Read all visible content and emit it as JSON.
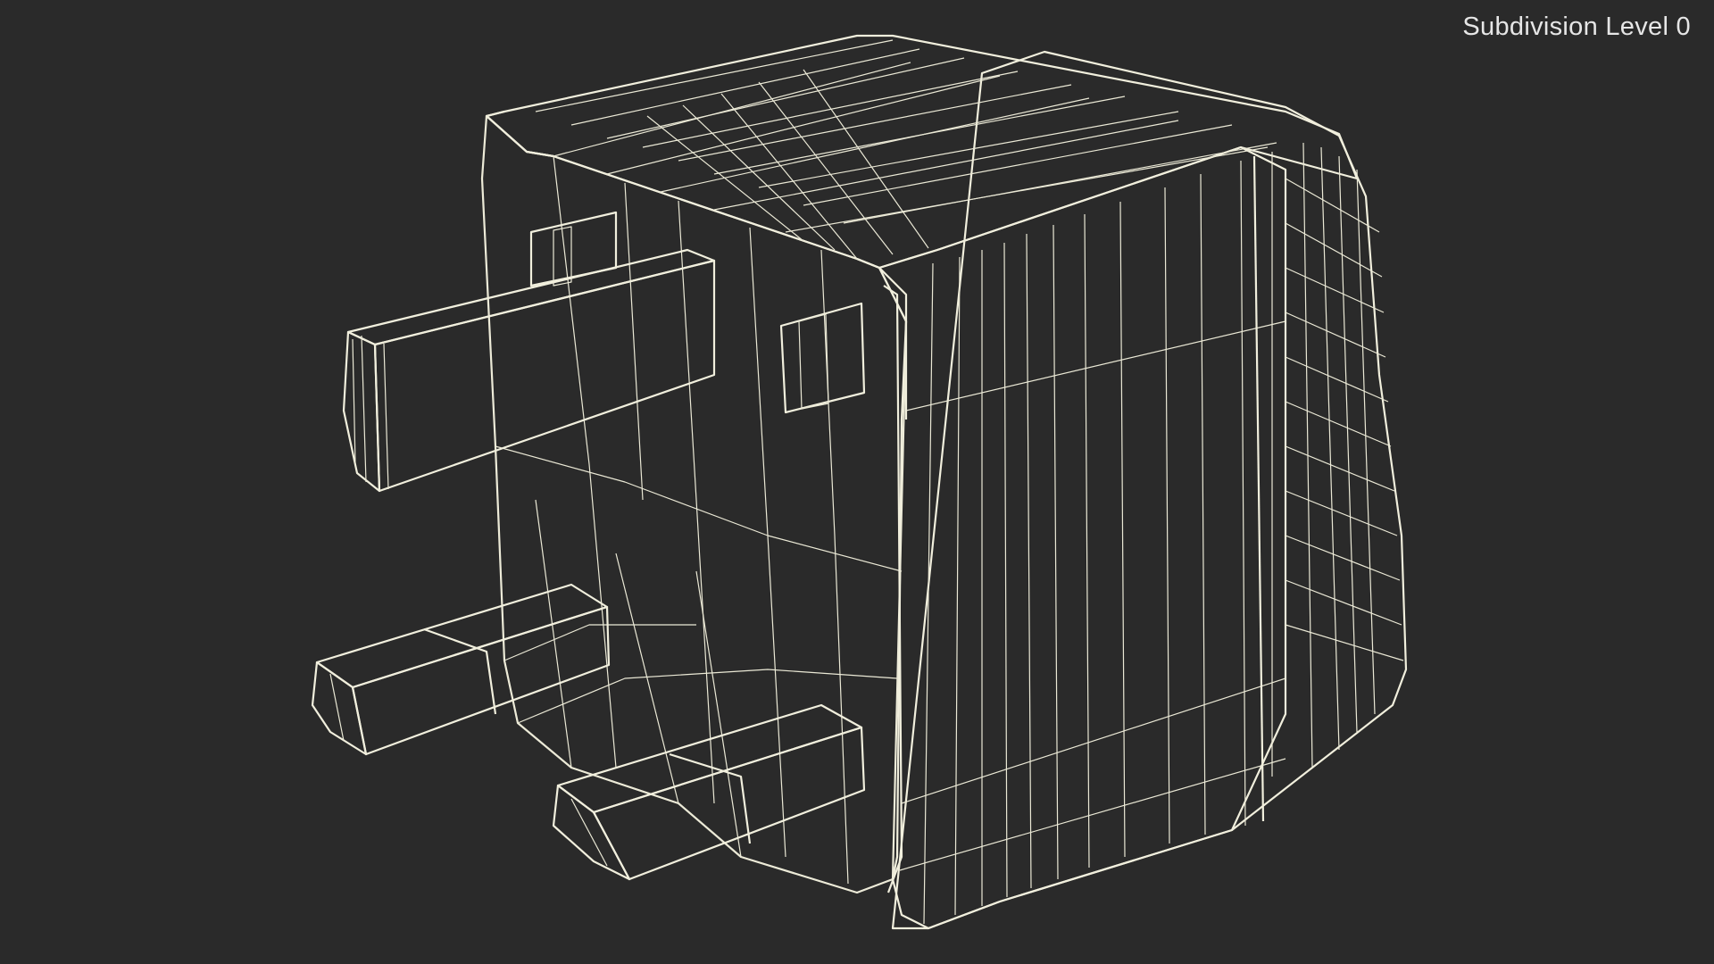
{
  "viewport": {
    "label": "Subdivision Level 0",
    "subject_icon": "uk-plug-wireframe-model",
    "colors": {
      "background": "#2a2a2a",
      "surface_lit": "#85857a",
      "surface_mid": "#77776d",
      "surface_dark": "#5c5c54",
      "wire": "#ebe9d6",
      "label": "#e6e6e6"
    }
  }
}
